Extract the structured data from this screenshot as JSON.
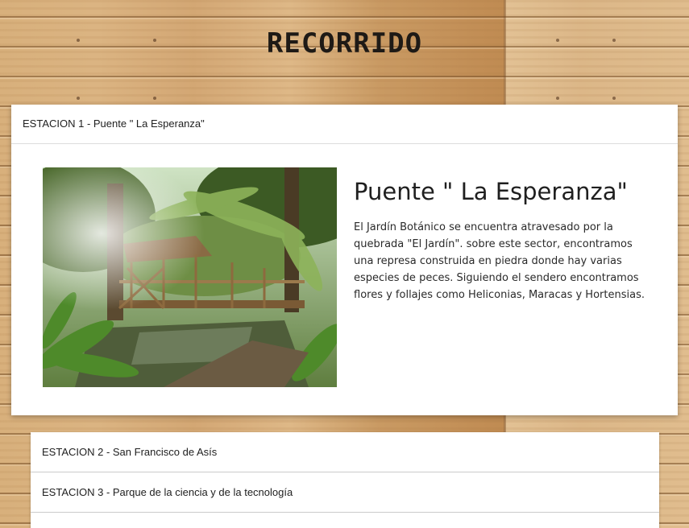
{
  "page": {
    "title": "RECORRIDO"
  },
  "stations": [
    {
      "header": "ESTACION 1 - Puente \" La Esperanza\"",
      "heading": "Puente \" La Esperanza\"",
      "description": "El Jardín Botánico se encuentra atravesado por la quebrada \"El Jardín\". sobre este sector, encontramos una represa construida en piedra donde hay varias especies de peces. Siguiendo el sendero encontramos flores y follajes como Heliconias, Maracas y Hortensias.",
      "expanded": true
    },
    {
      "header": "ESTACION 2 - San Francisco de Asís",
      "expanded": false
    },
    {
      "header": "ESTACION 3 - Parque de la ciencia y de la tecnología",
      "expanded": false
    },
    {
      "header": "",
      "expanded": false
    }
  ],
  "colors": {
    "panel_background": "#ffffff",
    "text": "#212121",
    "wood": "#d9b487"
  }
}
